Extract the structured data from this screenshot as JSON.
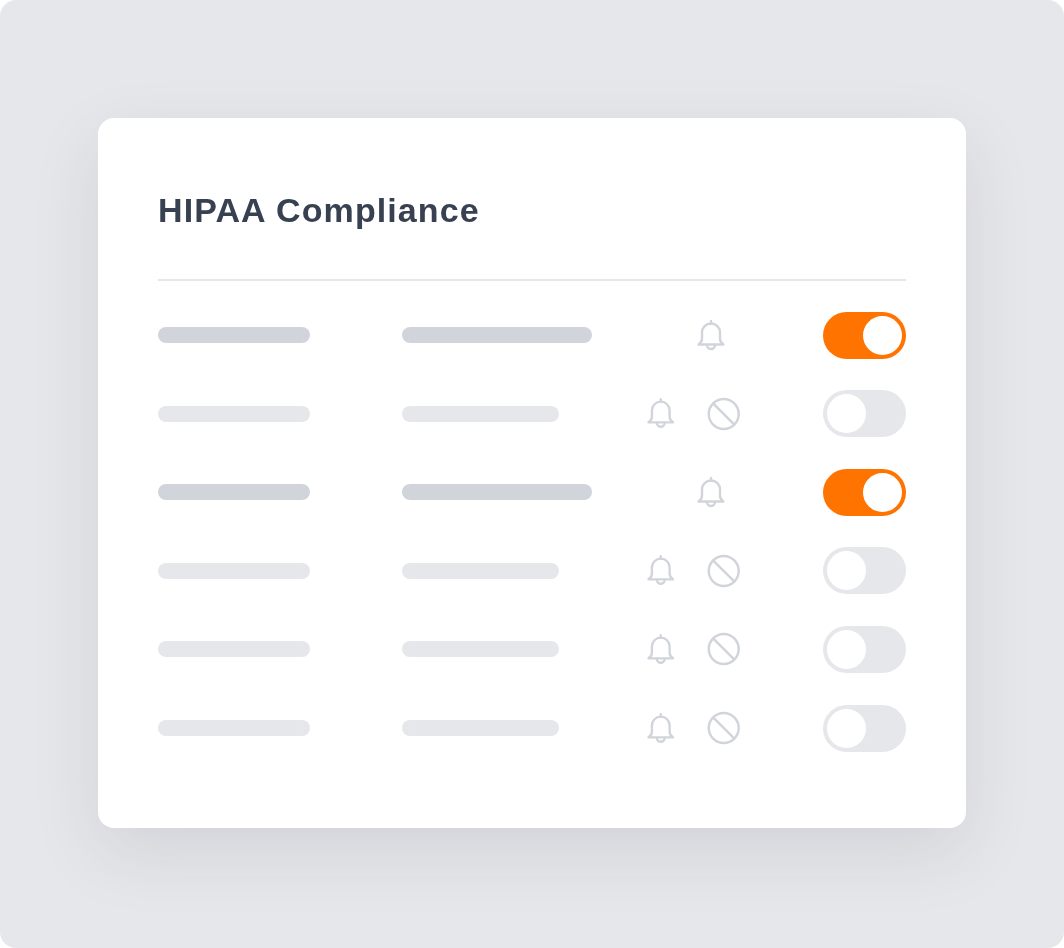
{
  "card": {
    "title": "HIPAA Compliance"
  },
  "rows": [
    {
      "on": true
    },
    {
      "on": false
    },
    {
      "on": true
    },
    {
      "on": false
    },
    {
      "on": false
    },
    {
      "on": false
    }
  ]
}
